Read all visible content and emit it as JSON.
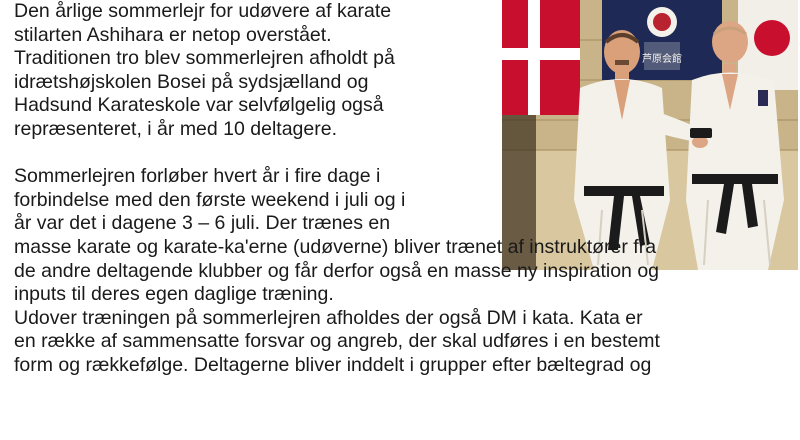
{
  "article": {
    "paragraph1": [
      "Den årlige sommerlejr for udøvere af karate",
      "stilarten Ashihara er netop overstået.",
      "Traditionen tro blev sommerlejren afholdt på",
      "idrætshøjskolen Bosei på sydsjælland og",
      "Hadsund Karateskole var selvfølgelig også",
      "repræsenteret, i år med 10 deltagere."
    ],
    "paragraph2": [
      "Sommerlejren forløber hvert år i fire dage i",
      "forbindelse med den første weekend i juli og i",
      "år var det i dagene 3 – 6 juli. Der trænes en",
      "masse karate og karate-ka'erne (udøverne) bliver trænet af instruktører fra",
      "de andre deltagende klubber og får derfor også en masse ny inspiration og",
      "inputs til deres egen daglige træning."
    ],
    "paragraph3": [
      "Udover træningen på sommerlejren afholdes der også DM i kata. Kata er",
      "en række af sammensatte forsvar og angreb, der skal udføres i en bestemt",
      "form og rækkefølge. Deltagerne bliver inddelt i grupper efter bæltegrad og"
    ]
  },
  "photo": {
    "banner_text": "芦原会館",
    "colors": {
      "wall": "#c9b48a",
      "danish_red": "#c8102e",
      "gi_white": "#f4f1ea",
      "belt_black": "#1b1b1b",
      "floor": "#d8c79f"
    }
  }
}
